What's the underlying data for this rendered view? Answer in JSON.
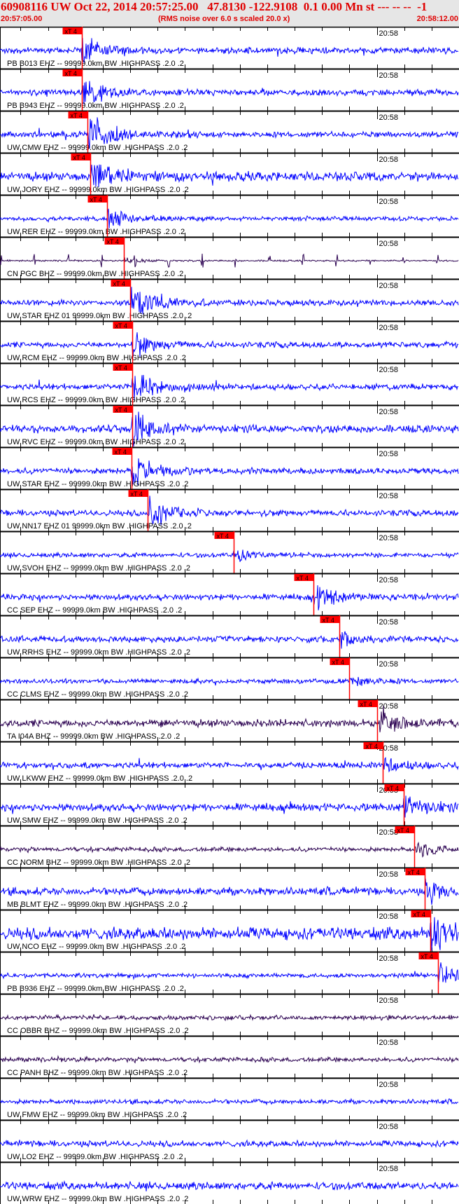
{
  "header": {
    "title": "60908116 UW Oct 22, 2014 20:57:25.00   47.8130 -122.9108  0.1 0.00 Mn st --- -- --  -1",
    "start_time": "20:57:05.00",
    "note": "(RMS noise over 6.0 s scaled 20.0 x)",
    "end_time": "20:58:12.00"
  },
  "chart_data": {
    "type": "line",
    "title": "Seismogram record section",
    "x_range_seconds": [
      0,
      67
    ],
    "minute_tick_label": "20:58",
    "minute_tick_seconds": 55,
    "tick_interval_seconds": 4,
    "pick_label": "xT 4",
    "colors": {
      "blue": "#0000ff",
      "dark": "#2a0050",
      "pick": "#ff0000"
    },
    "traces": [
      {
        "label": "PB B013 EHZ -- 99999.0km BW .HIGHPASS .2.0 .2",
        "pick": 11.9,
        "color": "blue",
        "noise": 4,
        "event": 18
      },
      {
        "label": "PB B943 EHZ -- 99999.0km BW .HIGHPASS .2.0 .2",
        "pick": 11.9,
        "color": "blue",
        "noise": 4,
        "event": 18
      },
      {
        "label": "UW CMW EHZ -- 99999.0km BW .HIGHPASS .2.0 .2",
        "pick": 12.8,
        "color": "blue",
        "noise": 4,
        "event": 28
      },
      {
        "label": "UW JORY EHZ -- 99999.0km BW .HIGHPASS .2.0 .2",
        "pick": 13.2,
        "color": "blue",
        "noise": 6,
        "event": 20
      },
      {
        "label": "UW RER EHZ -- 99999.0km BW .HIGHPASS .2.0 .2",
        "pick": 15.6,
        "color": "blue",
        "noise": 3,
        "event": 12
      },
      {
        "label": "CN PGC BHZ -- 99999.0km BW .HIGHPASS .2.0 .2",
        "pick": 18.1,
        "color": "dark",
        "noise": 1,
        "event": 3
      },
      {
        "label": "UW STAR EHZ 01 99999.0km BW .HIGHPASS .2.0 .2",
        "pick": 19.0,
        "color": "blue",
        "noise": 4,
        "event": 22
      },
      {
        "label": "UW RCM EHZ -- 99999.0km BW .HIGHPASS .2.0 .2",
        "pick": 19.3,
        "color": "blue",
        "noise": 4,
        "event": 14
      },
      {
        "label": "UW RCS EHZ -- 99999.0km BW .HIGHPASS .2.0 .2",
        "pick": 19.3,
        "color": "blue",
        "noise": 4,
        "event": 22
      },
      {
        "label": "UW RVC EHZ -- 99999.0km BW .HIGHPASS .2.0 .2",
        "pick": 19.3,
        "color": "blue",
        "noise": 5,
        "event": 20
      },
      {
        "label": "UW STAR EHZ -- 99999.0km BW .HIGHPASS .2.0 .2",
        "pick": 19.2,
        "color": "blue",
        "noise": 4,
        "event": 20
      },
      {
        "label": "UW NN17 EHZ 01 99999.0km BW .HIGHPASS .2.0 .2",
        "pick": 21.6,
        "color": "blue",
        "noise": 4,
        "event": 22
      },
      {
        "label": "UW SVOH EHZ -- 99999.0km BW .HIGHPASS .2.0 .2",
        "pick": 34.1,
        "color": "blue",
        "noise": 3,
        "event": 8
      },
      {
        "label": "CC SEP EHZ -- 99999.0km BW .HIGHPASS .2.0 .2",
        "pick": 45.8,
        "color": "blue",
        "noise": 4,
        "event": 14
      },
      {
        "label": "UW RRHS EHZ -- 99999.0km BW .HIGHPASS .2.0 .2",
        "pick": 49.5,
        "color": "blue",
        "noise": 4,
        "event": 10
      },
      {
        "label": "CC CLMS EHZ -- 99999.0km BW .HIGHPASS .2.0 .2",
        "pick": 51.0,
        "color": "blue",
        "noise": 3,
        "event": 8
      },
      {
        "label": "TA I04A BHZ -- 99999.0km BW .HIGHPASS .2.0 .2",
        "pick": 55.1,
        "color": "dark",
        "noise": 5,
        "event": 16
      },
      {
        "label": "UW LKWW EHZ -- 99999.0km BW .HIGHPASS .2.0 .2",
        "pick": 55.9,
        "color": "blue",
        "noise": 4,
        "event": 10
      },
      {
        "label": "UW SMW EHZ -- 99999.0km BW .HIGHPASS .2.0 .2",
        "pick": 58.9,
        "color": "blue",
        "noise": 5,
        "event": 14
      },
      {
        "label": "CC NORM BHZ -- 99999.0km BW .HIGHPASS .2.0 .2",
        "pick": 60.5,
        "color": "dark",
        "noise": 3,
        "event": 10
      },
      {
        "label": "MB BLMT EHZ -- 99999.0km BW .HIGHPASS .2.0 .2",
        "pick": 62.0,
        "color": "blue",
        "noise": 5,
        "event": 18
      },
      {
        "label": "UW NCO EHZ -- 99999.0km BW .HIGHPASS .2.0 .2",
        "pick": 62.8,
        "color": "blue",
        "noise": 8,
        "event": 22
      },
      {
        "label": "PB B936 EHZ -- 99999.0km BW .HIGHPASS .2.0 .2",
        "pick": 63.9,
        "color": "blue",
        "noise": 3,
        "event": 16
      },
      {
        "label": "CC OBBR BHZ -- 99999.0km BW .HIGHPASS .2.0 .2",
        "pick": null,
        "color": "dark",
        "noise": 3,
        "event": 0
      },
      {
        "label": "CC PANH BHZ -- 99999.0km BW .HIGHPASS .2.0 .2",
        "pick": null,
        "color": "dark",
        "noise": 3,
        "event": 0
      },
      {
        "label": "UW FMW EHZ -- 99999.0km BW .HIGHPASS .2.0 .2",
        "pick": null,
        "color": "blue",
        "noise": 3,
        "event": 0
      },
      {
        "label": "UW LO2 EHZ -- 99999.0km BW .HIGHPASS .2.0 .2",
        "pick": null,
        "color": "blue",
        "noise": 4,
        "event": 0
      },
      {
        "label": "UW WRW EHZ -- 99999.0km BW .HIGHPASS .2.0 .2",
        "pick": null,
        "color": "blue",
        "noise": 5,
        "event": 0
      }
    ]
  }
}
